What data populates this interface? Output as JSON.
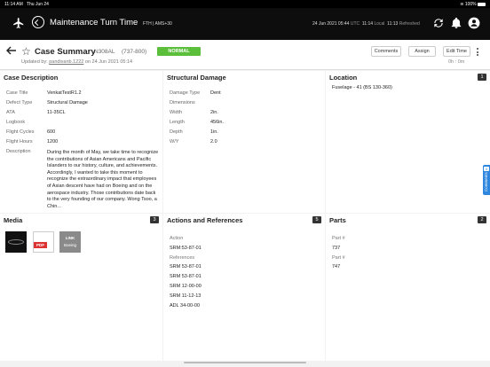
{
  "status_bar": {
    "time": "11:14 AM",
    "date": "Thu Jun 24",
    "battery": "100%"
  },
  "app": {
    "title": "Maintenance Turn Time",
    "station": "FTH | AMS+30",
    "date": "24 Jun 2021 05:44",
    "tz_utc": "UTC",
    "local_time": "11:14",
    "local_label": "Local",
    "refreshed_time": "11:13",
    "refreshed_label": "Refreshed"
  },
  "case": {
    "title": "Case Summary",
    "tail": "N308AL",
    "aircraft": "(737-800)",
    "updated_prefix": "Updated by:",
    "updated_user": "pandivanb.1222",
    "updated_suffix": "on 24 Jun 2021 05:14",
    "status": "NORMAL",
    "buttons": {
      "comments": "Comments",
      "assign": "Assign",
      "edit_time": "Edit Time"
    },
    "elapsed": "0h : 0m"
  },
  "case_description": {
    "title": "Case Description",
    "fields": [
      {
        "label": "Case Title",
        "value": "VenkatTestR1.2"
      },
      {
        "label": "Defect Type",
        "value": "Structural Damage"
      },
      {
        "label": "ATA",
        "value": "11-35CL"
      },
      {
        "label": "Logbook",
        "value": ""
      },
      {
        "label": "Flight Cycles",
        "value": "600"
      },
      {
        "label": "Flight Hours",
        "value": "1200"
      }
    ],
    "description_label": "Description",
    "description": "During the month of May, we take time to recognize the contributions of Asian Americans and Pacific Islanders to our history, culture, and achievements. Accordingly, I wanted to take this moment to recognize the extraordinary impact that employees of Asian descent have had on Boeing and on the aerospace industry. Those contributions date back to the very founding of our company. Wong Tsoo, a Chin..."
  },
  "structural_damage": {
    "title": "Structural Damage",
    "damage_type_label": "Damage Type",
    "damage_type": "Dent",
    "dimensions_label": "Dimensions",
    "dims": [
      {
        "label": "Width",
        "value": "2in."
      },
      {
        "label": "Length",
        "value": "456in."
      },
      {
        "label": "Depth",
        "value": "1in."
      },
      {
        "label": "W/Y",
        "value": "2.0"
      }
    ]
  },
  "location": {
    "title": "Location",
    "count": "1",
    "items": [
      "Fuselage - 41 (BS 130-360)"
    ]
  },
  "media": {
    "title": "Media",
    "count": "3",
    "pdf_label": "PDF",
    "link_label": "LINK",
    "link_text": "Boeing"
  },
  "actions": {
    "title": "Actions and References",
    "count": "5",
    "action_label": "Action",
    "action": "SRM:53-87-01",
    "references_label": "References",
    "references": [
      "SRM 53-87-01",
      "SRM 53-87-01",
      "SRM 12-00-00",
      "SRM 11-12-13",
      "ADL 34-00-00"
    ]
  },
  "parts": {
    "title": "Parts",
    "count": "2",
    "items": [
      {
        "label": "Part #",
        "value": "737"
      },
      {
        "label": "Part #",
        "value": "747"
      }
    ]
  },
  "comments_tab": {
    "label": "Comments",
    "count": "0"
  }
}
